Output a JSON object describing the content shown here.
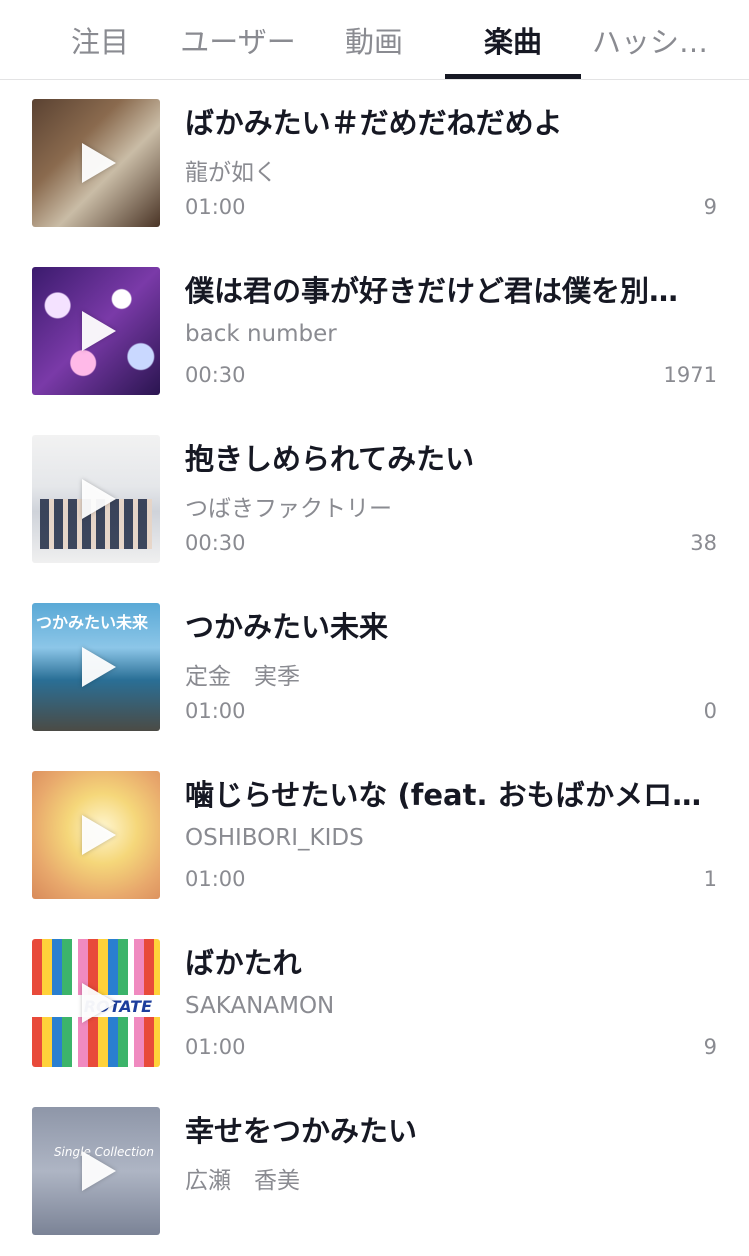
{
  "tabs": [
    {
      "label": "注目",
      "active": false
    },
    {
      "label": "ユーザー",
      "active": false
    },
    {
      "label": "動画",
      "active": false
    },
    {
      "label": "楽曲",
      "active": true
    },
    {
      "label": "ハッシ…",
      "active": false
    }
  ],
  "songs": [
    {
      "title": "ばかみたい＃だめだねだめよ",
      "artist": "龍が如く",
      "duration": "01:00",
      "count": "9",
      "cover_icon": "album-cover"
    },
    {
      "title": "僕は君の事が好きだけど君は僕を別…",
      "artist": "back number",
      "duration": "00:30",
      "count": "1971",
      "cover_icon": "album-cover"
    },
    {
      "title": "抱きしめられてみたい",
      "artist": "つばきファクトリー",
      "duration": "00:30",
      "count": "38",
      "cover_icon": "album-cover"
    },
    {
      "title": "つかみたい未来",
      "artist": "定金　実季",
      "duration": "01:00",
      "count": "0",
      "cover_icon": "album-cover",
      "cover_text": "つかみたい未来"
    },
    {
      "title": "噛じらせたいな (feat. おもばかメロデ…",
      "artist": "OSHIBORI_KIDS",
      "duration": "01:00",
      "count": "1",
      "cover_icon": "album-cover"
    },
    {
      "title": "ばかたれ",
      "artist": "SAKANAMON",
      "duration": "01:00",
      "count": "9",
      "cover_icon": "album-cover",
      "cover_text": "ROTATE"
    },
    {
      "title": "幸せをつかみたい",
      "artist": "広瀬　香美",
      "duration": "",
      "count": "",
      "cover_icon": "album-cover",
      "cover_text": "Single Collection"
    }
  ]
}
